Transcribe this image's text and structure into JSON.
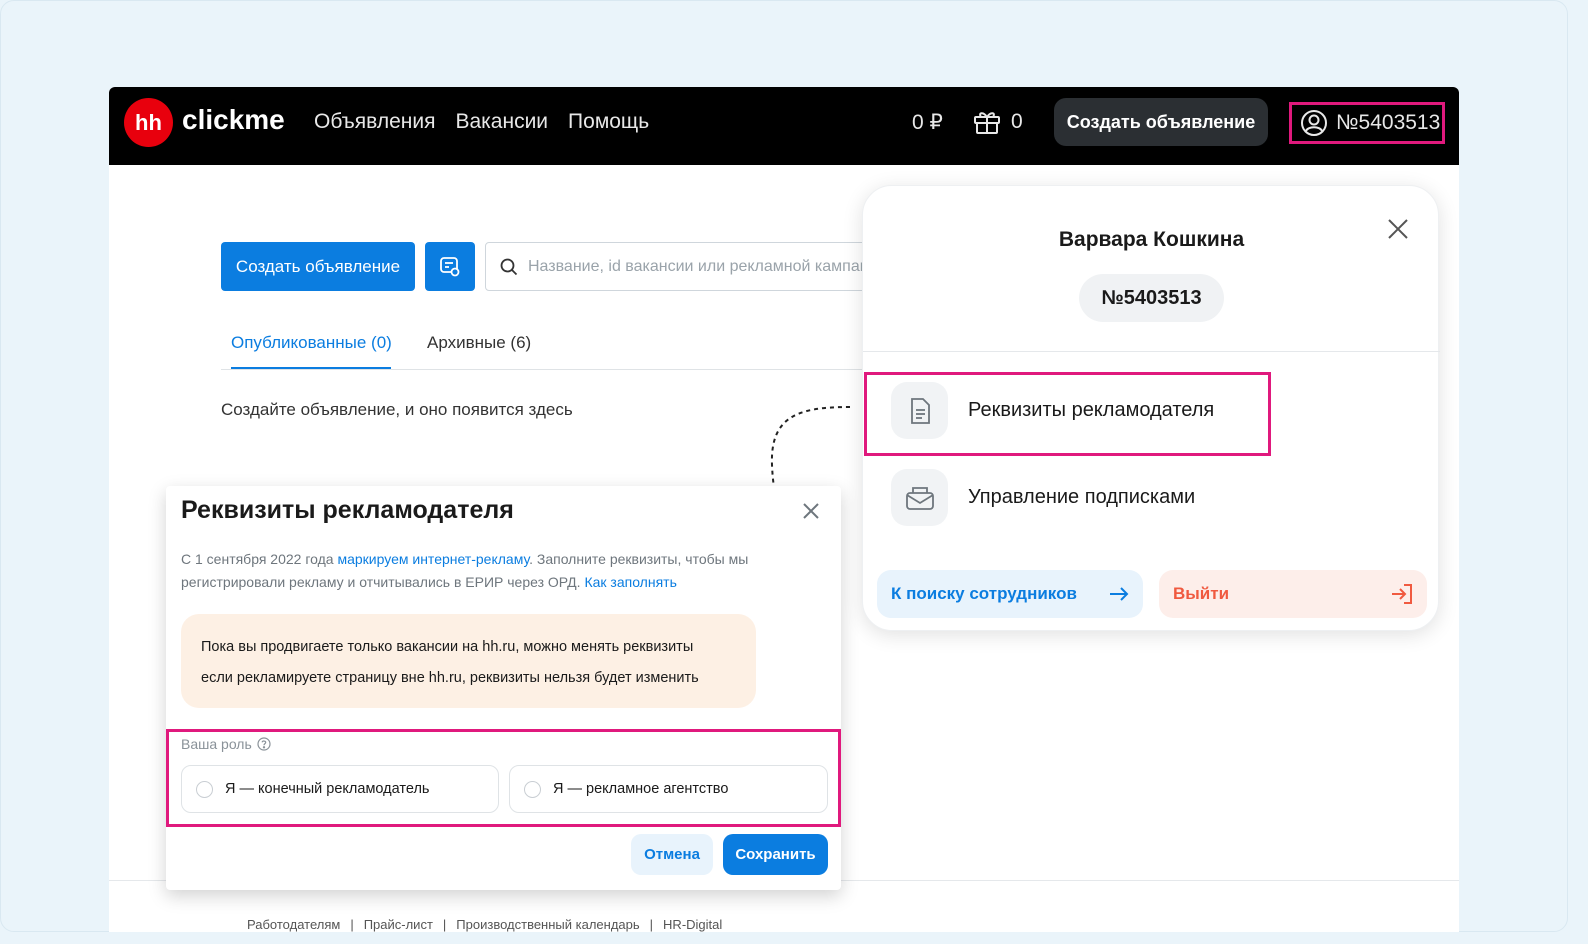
{
  "header": {
    "logo_badge": "hh",
    "logo_text": "clickme",
    "nav": [
      "Объявления",
      "Вакансии",
      "Помощь"
    ],
    "balance": "0 ₽",
    "gifts_count": "0",
    "create_button": "Создать объявление",
    "account_id": "№5403513"
  },
  "toolbar": {
    "create_button": "Создать объявление",
    "search_placeholder": "Название, id вакансии или рекламной кампании"
  },
  "tabs": {
    "published": "Опубликованные (0)",
    "archived": "Архивные (6)"
  },
  "empty_state": "Создайте объявление, и оно появится здесь",
  "footer": {
    "links": [
      "Работодателям",
      "Прайс-лист",
      "Производственный календарь",
      "HR-Digital"
    ],
    "separator": "|"
  },
  "modal": {
    "title": "Реквизиты рекламодателя",
    "desc_part1": "С 1 сентября 2022 года ",
    "desc_link1": "маркируем интернет-рекламу",
    "desc_part2": ". Заполните реквизиты, чтобы мы регистрировали рекламу и отчитывались в ЕРИР через ОРД. ",
    "desc_link2": "Как заполнять",
    "notice_line1": "Пока вы продвигаете только вакансии на hh.ru, можно менять реквизиты",
    "notice_line2": "если рекламируете страницу вне hh.ru, реквизиты нельзя будет изменить",
    "role_label": "Ваша роль",
    "role_options": [
      "Я — конечный рекламодатель",
      "Я — рекламное агентство"
    ],
    "cancel": "Отмена",
    "save": "Сохранить"
  },
  "dropdown": {
    "user_name": "Варвара Кошкина",
    "user_id": "№5403513",
    "items": [
      "Реквизиты рекламодателя",
      "Управление подписками"
    ],
    "search_button": "К поиску сотрудников",
    "logout_button": "Выйти"
  },
  "colors": {
    "accent_blue": "#0b7de0",
    "brand_red": "#e8000d",
    "highlight_magenta": "#e0197d",
    "logout_red": "#f05a40"
  }
}
